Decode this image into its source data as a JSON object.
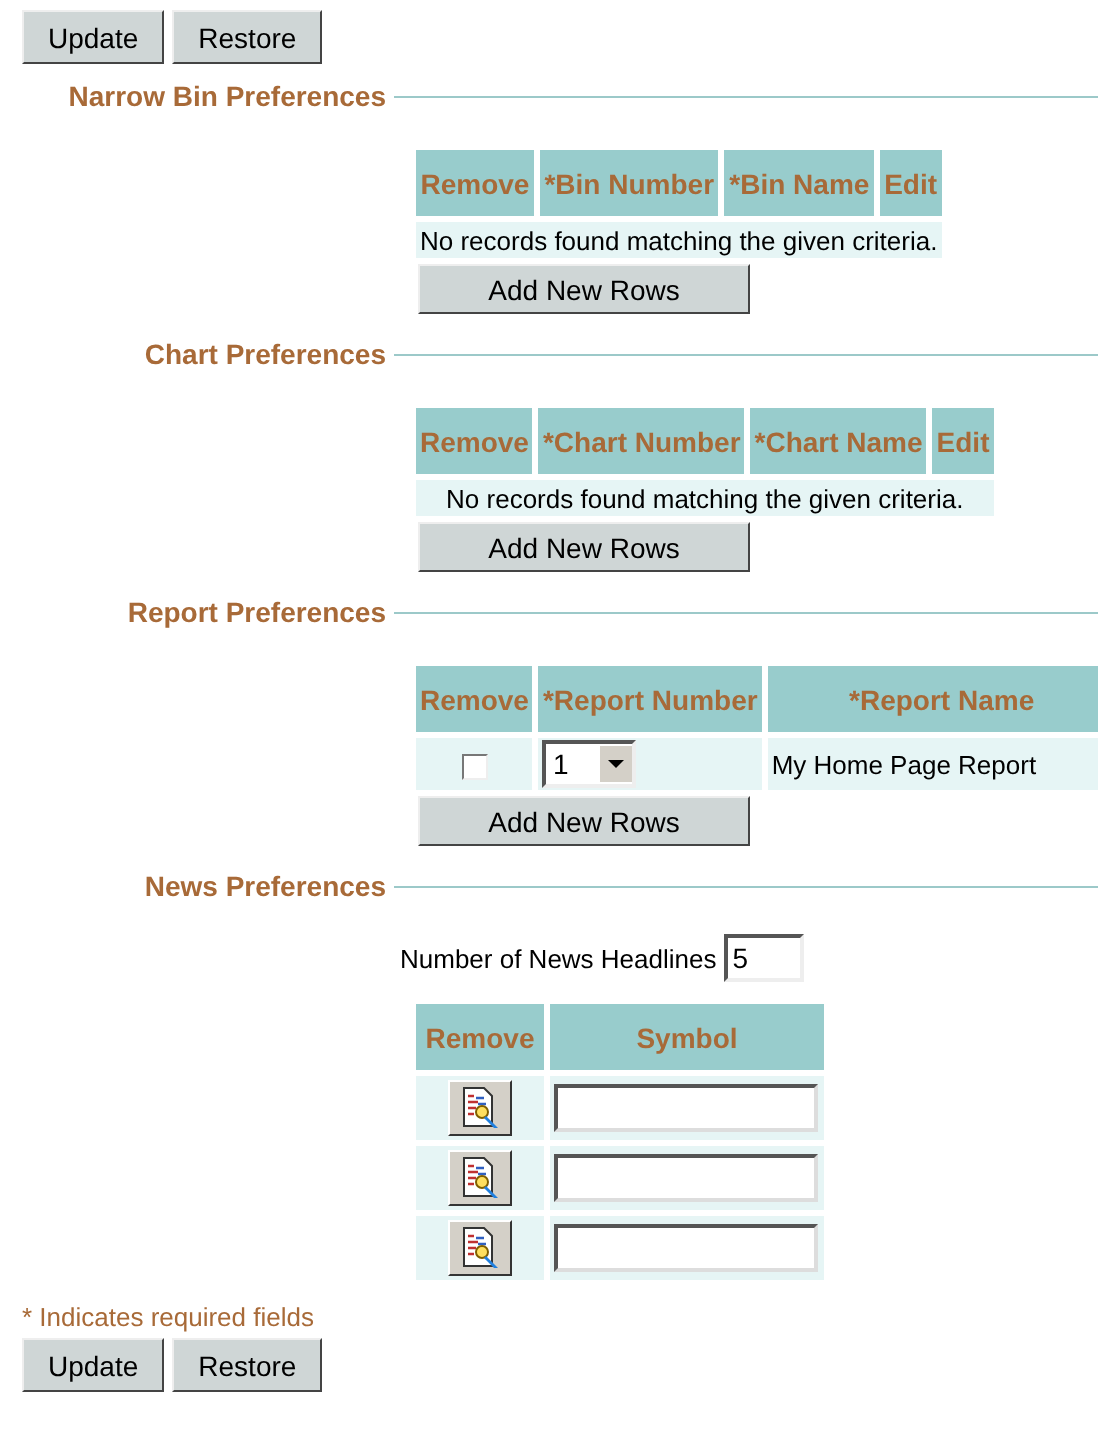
{
  "top_buttons": [
    "Update",
    "Restore"
  ],
  "sections": [
    {
      "title": "Narrow Bin Preferences",
      "kind": "table",
      "columns": [
        "Remove",
        "*Bin Number",
        "*Bin Name",
        "Edit"
      ],
      "empty_message": "No records found matching the given criteria.",
      "add_button": "Add New Rows"
    },
    {
      "title": "Chart Preferences",
      "kind": "table",
      "columns": [
        "Remove",
        "*Chart Number",
        "*Chart Name",
        "Edit"
      ],
      "empty_message": "No records found matching the given criteria.",
      "add_button": "Add New Rows"
    },
    {
      "title": "Report Preferences",
      "kind": "table",
      "columns": [
        "Remove",
        "*Report Number",
        "*Report Name"
      ],
      "rows": [
        {
          "checked": false,
          "number": "1",
          "name": "My Home Page Report"
        }
      ],
      "add_button": "Add New Rows"
    },
    {
      "title": "News Preferences",
      "kind": "news",
      "headlines_label": "Number of News Headlines",
      "headlines_value": "5",
      "columns": [
        "Remove",
        "Symbol"
      ],
      "rows": [
        {
          "kind": "symbol-input"
        },
        {
          "kind": "symbol-input"
        },
        {
          "kind": "symbol-input"
        }
      ]
    }
  ],
  "footnote": "* Indicates required fields",
  "bottom_buttons": [
    "Update",
    "Restore"
  ]
}
